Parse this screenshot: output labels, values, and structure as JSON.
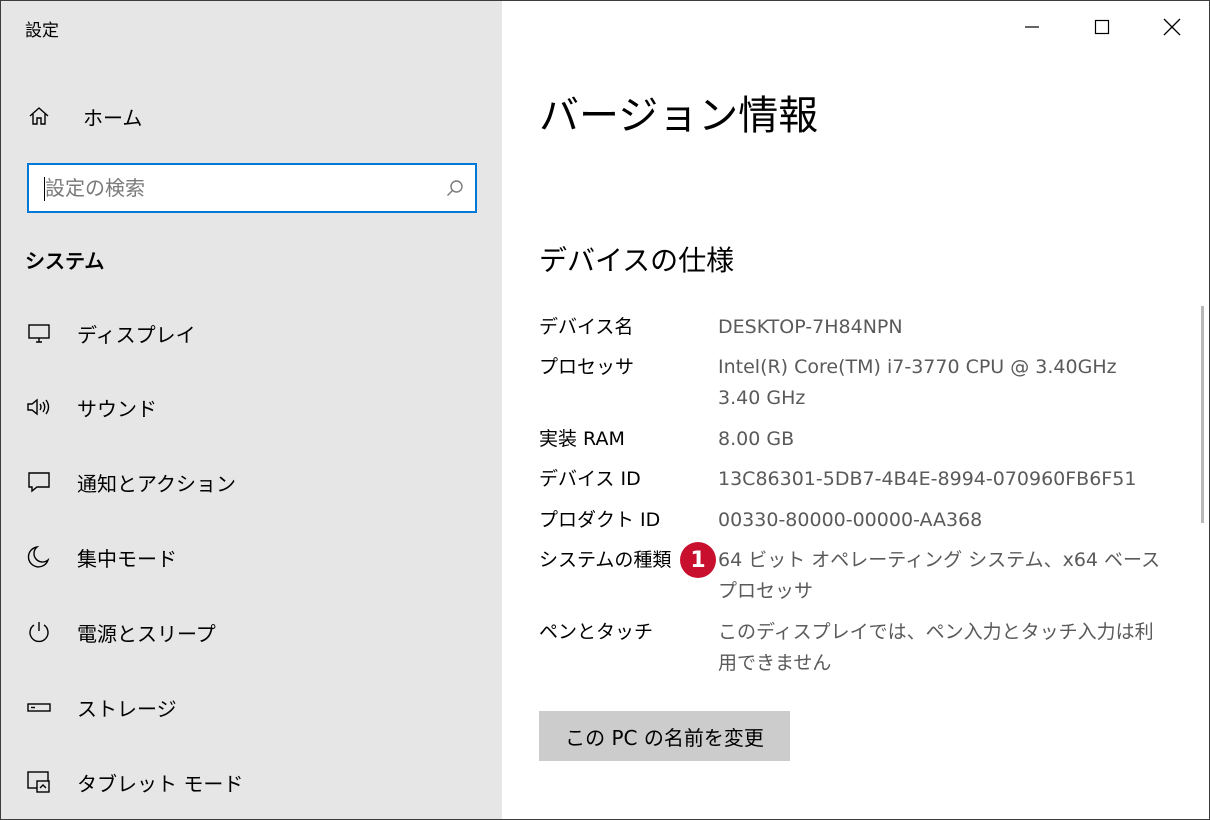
{
  "window": {
    "title": "設定"
  },
  "sidebar": {
    "home_label": "ホーム",
    "search_placeholder": "設定の検索",
    "section_label": "システム",
    "items": [
      {
        "label": "ディスプレイ",
        "icon": "monitor-icon"
      },
      {
        "label": "サウンド",
        "icon": "speaker-icon"
      },
      {
        "label": "通知とアクション",
        "icon": "notification-icon"
      },
      {
        "label": "集中モード",
        "icon": "moon-icon"
      },
      {
        "label": "電源とスリープ",
        "icon": "power-icon"
      },
      {
        "label": "ストレージ",
        "icon": "storage-icon"
      },
      {
        "label": "タブレット モード",
        "icon": "tablet-mode-icon"
      }
    ]
  },
  "main": {
    "page_title": "バージョン情報",
    "section_title": "デバイスの仕様",
    "specs": [
      {
        "key": "デバイス名",
        "value": "DESKTOP-7H84NPN"
      },
      {
        "key": "プロセッサ",
        "value": "Intel(R) Core(TM) i7-3770 CPU @ 3.40GHz 3.40 GHz"
      },
      {
        "key": "実装 RAM",
        "value": "8.00 GB"
      },
      {
        "key": "デバイス ID",
        "value": "13C86301-5DB7-4B4E-8994-070960FB6F51"
      },
      {
        "key": "プロダクト ID",
        "value": "00330-80000-00000-AA368"
      },
      {
        "key": "システムの種類",
        "value": "64 ビット オペレーティング システム、x64 ベース プロセッサ"
      },
      {
        "key": "ペンとタッチ",
        "value": "このディスプレイでは、ペン入力とタッチ入力は利用できません"
      }
    ],
    "annotation_badge": "1",
    "rename_button": "この PC の名前を変更"
  },
  "colors": {
    "sidebar_bg": "#e6e6e6",
    "accent": "#0078d7",
    "badge": "#c8102e",
    "button_bg": "#cccccc"
  }
}
